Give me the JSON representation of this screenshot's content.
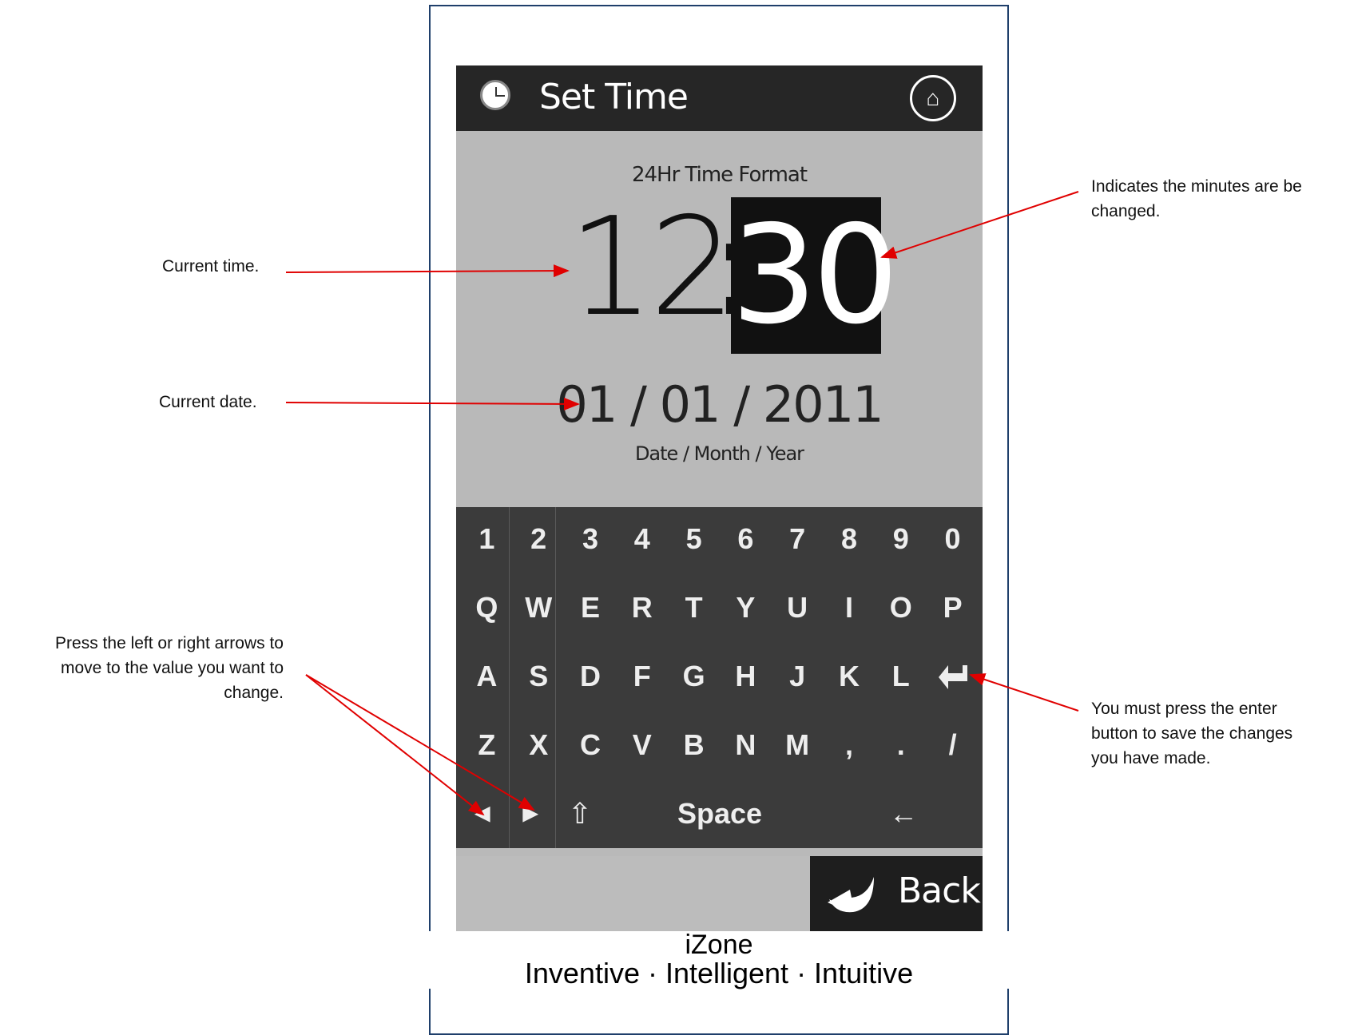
{
  "screen": {
    "title": "Set Time",
    "home_icon": "home-icon",
    "clock_icon": "clock-icon",
    "time_format_label": "24Hr Time Format",
    "time_hours": "12",
    "time_separator": ":",
    "time_minutes": "30",
    "date_value": "01 / 01 / 2011",
    "date_format_label": "Date / Month / Year",
    "back_label": "Back"
  },
  "keyboard": {
    "row_numbers": [
      "1",
      "2",
      "3",
      "4",
      "5",
      "6",
      "7",
      "8",
      "9",
      "0"
    ],
    "row_qwerty": [
      "Q",
      "W",
      "E",
      "R",
      "T",
      "Y",
      "U",
      "I",
      "O",
      "P"
    ],
    "row_asdf": [
      "A",
      "S",
      "D",
      "F",
      "G",
      "H",
      "J",
      "K",
      "L"
    ],
    "enter_icon": "enter-icon",
    "row_zxcv": [
      "Z",
      "X",
      "C",
      "V",
      "B",
      "N",
      "M",
      ",",
      ".",
      "/"
    ],
    "left_arrow": "◀",
    "right_arrow": "▶",
    "shift": "⇧",
    "space_label": "Space",
    "backspace": "←"
  },
  "branding": {
    "name": "iZone",
    "tagline": "Inventive · Intelligent · Intuitive"
  },
  "annotations": {
    "current_time": "Current time.",
    "current_date": "Current date.",
    "arrows_line1": "Press the left or right arrows to",
    "arrows_line2": "move to the  value you want to",
    "arrows_line3": "change.",
    "minutes_line1": "Indicates the minutes are be",
    "minutes_line2": "changed.",
    "enter_line1": "You must press the enter",
    "enter_line2": "button to save the changes",
    "enter_line3": "you have made."
  },
  "colors": {
    "arrow": "#e00000",
    "frame_border": "#1f3f6b",
    "titlebar": "#262626",
    "keyboard": "#3b3b3b",
    "panel": "#b9b9b9"
  }
}
